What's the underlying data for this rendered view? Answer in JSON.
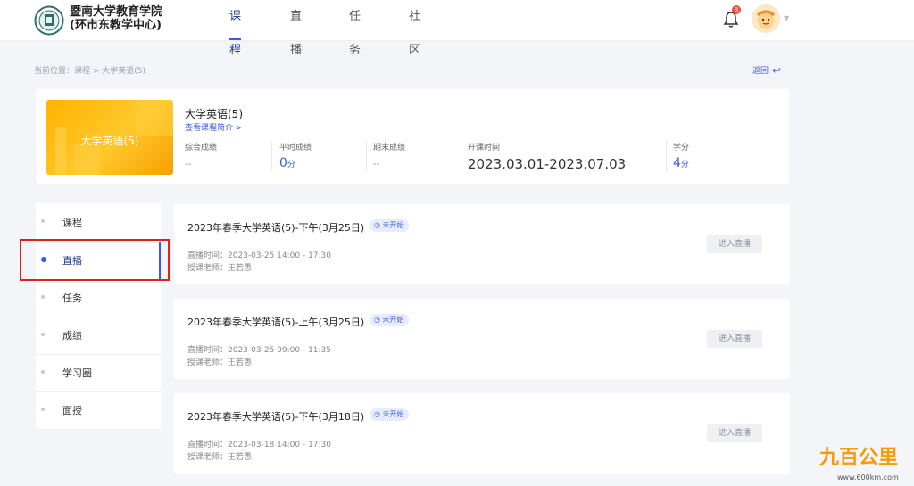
{
  "brand": {
    "name_line1": "暨南大学教育学院",
    "name_line2": "(环市东教学中心)"
  },
  "nav": [
    {
      "label": "课程",
      "active": true
    },
    {
      "label": "直播",
      "active": false
    },
    {
      "label": "任务",
      "active": false
    },
    {
      "label": "社区",
      "active": false
    }
  ],
  "header": {
    "notification_count": "8"
  },
  "breadcrumb": "当前位置：课程 > 大学英语(5)",
  "back_label": "返回",
  "course": {
    "cover_title": "大学英语(5)",
    "name": "大学英语(5)",
    "intro_link": "查看课程简介 >",
    "stats": [
      {
        "label": "综合成绩",
        "value": "--",
        "unit": ""
      },
      {
        "label": "平时成绩",
        "value": "0",
        "unit": "分"
      },
      {
        "label": "期末成绩",
        "value": "--",
        "unit": ""
      },
      {
        "label": "开课时间",
        "value": "2023.03.01-2023.07.03",
        "unit": ""
      },
      {
        "label": "学分",
        "value": "4",
        "unit": "分"
      }
    ]
  },
  "sidebar": {
    "items": [
      {
        "label": "课程",
        "active": false
      },
      {
        "label": "直播",
        "active": true
      },
      {
        "label": "任务",
        "active": false
      },
      {
        "label": "成绩",
        "active": false
      },
      {
        "label": "学习圈",
        "active": false
      },
      {
        "label": "面授",
        "active": false
      }
    ]
  },
  "lives": [
    {
      "title": "2023年春季大学英语(5)-下午(3月25日)",
      "status": "未开始",
      "time": "直播时间：2023-03-25 14:00 - 17:30",
      "teacher": "授课老师：王若愚",
      "button": "进入直播"
    },
    {
      "title": "2023年春季大学英语(5)-上午(3月25日)",
      "status": "未开始",
      "time": "直播时间：2023-03-25 09:00 - 11:35",
      "teacher": "授课老师：王若愚",
      "button": "进入直播"
    },
    {
      "title": "2023年春季大学英语(5)-下午(3月18日)",
      "status": "未开始",
      "time": "直播时间：2023-03-18 14:00 - 17:30",
      "teacher": "授课老师：王若愚",
      "button": "进入直播"
    }
  ],
  "watermark": {
    "text": "九百公里",
    "url": "www.600km.com"
  },
  "colors": {
    "accent": "#3b5bdb",
    "highlight": "#e0201c",
    "cover": "#ffb300"
  }
}
